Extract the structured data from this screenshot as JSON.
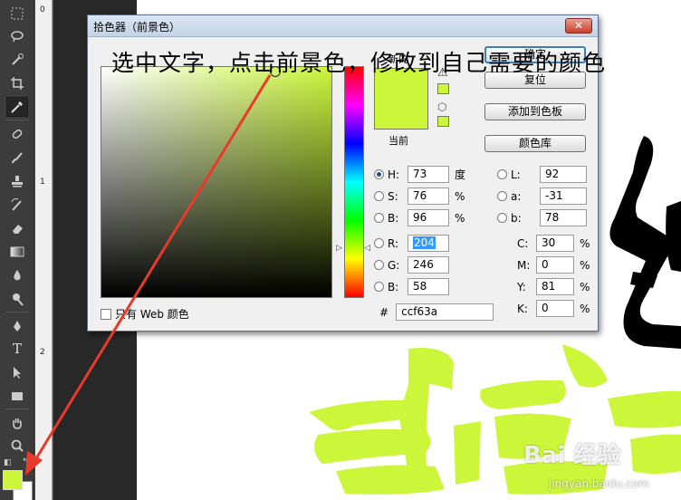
{
  "colors": {
    "selected": "#ccf63a",
    "calligraphy": "#ccf63a",
    "arrow": "#e83a2a"
  },
  "toolbar": {
    "tools": [
      "marquee-icon",
      "lasso-icon",
      "quick-select-icon",
      "crop-icon",
      "eyedropper-icon",
      "healing-brush-icon",
      "brush-icon",
      "stamp-icon",
      "history-brush-icon",
      "eraser-icon",
      "gradient-icon",
      "blur-icon",
      "dodge-icon",
      "pen-icon",
      "type-icon",
      "path-select-icon",
      "rectangle-icon",
      "hand-icon",
      "zoom-icon"
    ],
    "type_glyph": "T"
  },
  "ruler": {
    "marks": [
      "0",
      "1",
      "2"
    ]
  },
  "dialog": {
    "title": "拾色器（前景色）",
    "close_label": "✕",
    "new_label": "新的",
    "current_label": "当前",
    "buttons": {
      "ok": "确定",
      "reset": "复位",
      "add_swatch": "添加到色板",
      "libraries": "颜色库"
    },
    "hsb": {
      "h": {
        "label": "H:",
        "value": "73",
        "unit": "度"
      },
      "s": {
        "label": "S:",
        "value": "76",
        "unit": "%"
      },
      "b": {
        "label": "B:",
        "value": "96",
        "unit": "%"
      }
    },
    "rgb": {
      "r": {
        "label": "R:",
        "value": "204"
      },
      "g": {
        "label": "G:",
        "value": "246"
      },
      "b": {
        "label": "B:",
        "value": "58"
      }
    },
    "lab": {
      "l": {
        "label": "L:",
        "value": "92"
      },
      "a": {
        "label": "a:",
        "value": "-31"
      },
      "b": {
        "label": "b:",
        "value": "78"
      }
    },
    "cmyk": {
      "c": {
        "label": "C:",
        "value": "30",
        "unit": "%"
      },
      "m": {
        "label": "M:",
        "value": "0",
        "unit": "%"
      },
      "y": {
        "label": "Y:",
        "value": "81",
        "unit": "%"
      },
      "k": {
        "label": "K:",
        "value": "0",
        "unit": "%"
      }
    },
    "web_only_label": "只有 Web 颜色",
    "hash_label": "#",
    "hex_value": "ccf63a"
  },
  "instruction_text": "选中文字，点击前景色，修改到自己需要的颜色",
  "watermark": {
    "brand": "Bai 经验",
    "url": "jingyan.baidu.com"
  }
}
